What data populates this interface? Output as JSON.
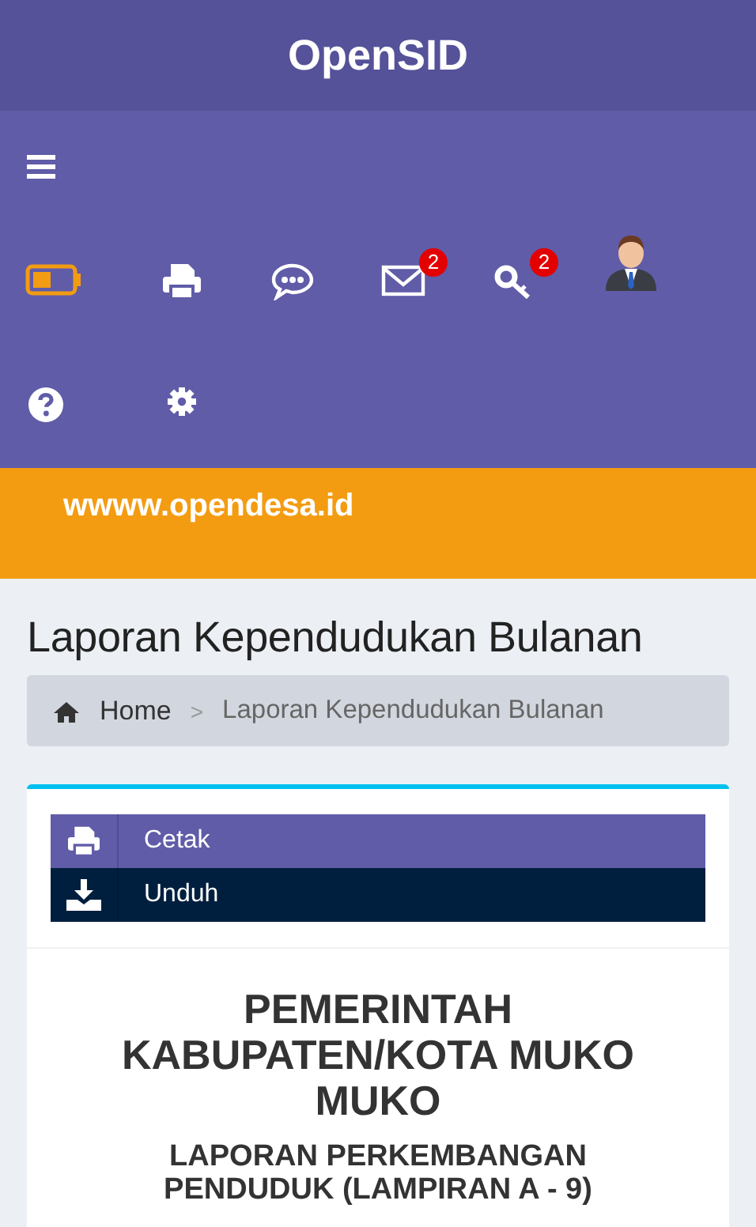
{
  "header": {
    "title": "OpenSID"
  },
  "navbar": {
    "toolbar": [
      {
        "kind": "battery"
      },
      {
        "kind": "printer"
      },
      {
        "kind": "chat"
      },
      {
        "kind": "mail",
        "badge": "2"
      },
      {
        "kind": "key",
        "badge": "2"
      },
      {
        "kind": "user"
      },
      {
        "kind": "help"
      },
      {
        "kind": "settings"
      }
    ]
  },
  "banner": {
    "text": "wwww.opendesa.id"
  },
  "page": {
    "title": "Laporan Kependudukan Bulanan",
    "breadcrumb_separator": ">",
    "breadcrumb": [
      {
        "label": "Home",
        "kind": "home"
      },
      {
        "label": "Laporan Kependudukan Bulanan",
        "kind": "current"
      }
    ]
  },
  "actions": [
    {
      "label": "Cetak",
      "kind": "print"
    },
    {
      "label": "Unduh",
      "kind": "download"
    }
  ],
  "report": {
    "heading": "PEMERINTAH KABUPATEN/KOTA MUKO MUKO",
    "subheading": "LAPORAN PERKEMBANGAN PENDUDUK (LAMPIRAN A - 9)"
  }
}
